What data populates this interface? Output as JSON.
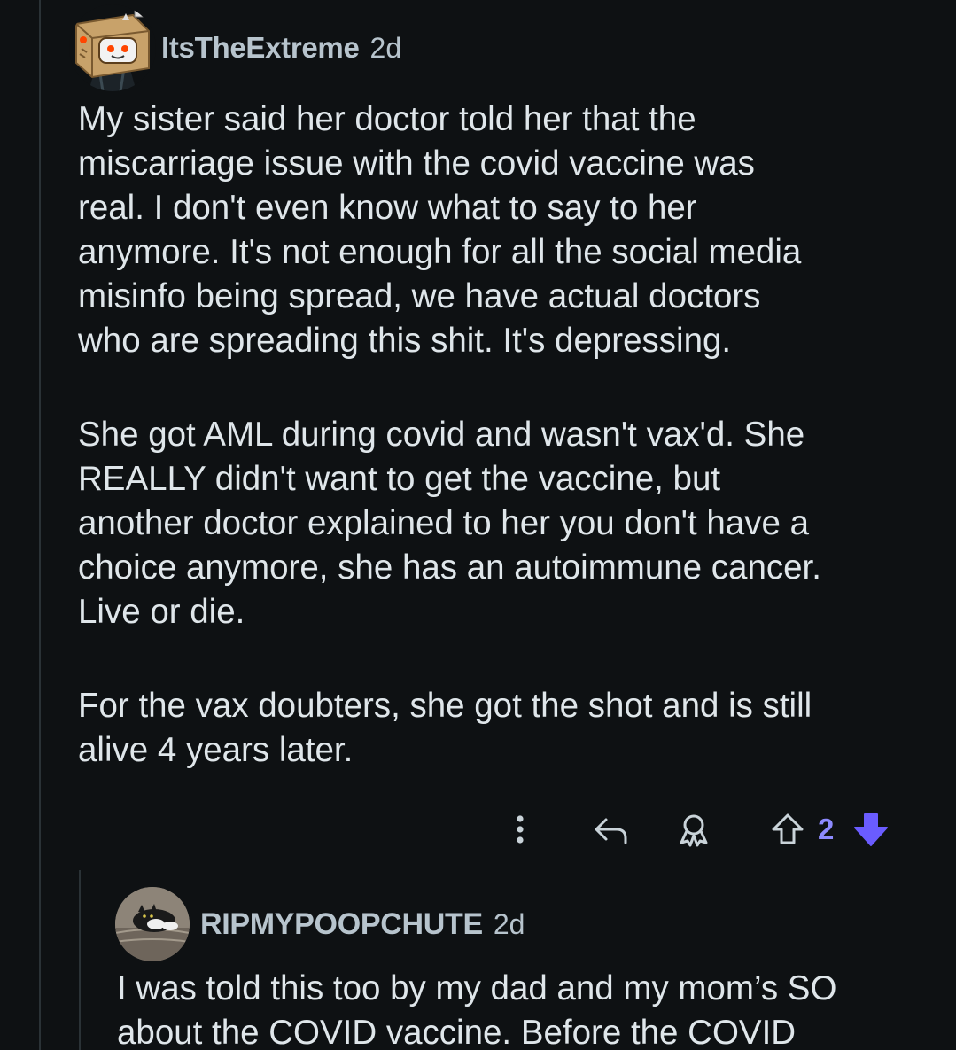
{
  "comments": [
    {
      "username": "ItsTheExtreme",
      "age": "2d",
      "avatar": "reddit-snoo-box-head-avatar",
      "paragraphs": [
        [
          "My sister said her doctor told her that the",
          "miscarriage issue with the covid vaccine was",
          "real. I don't even know what to say to her",
          "anymore. It's not enough for all the social media",
          "misinfo being spread, we have actual doctors",
          "who are spreading this shit. It's depressing."
        ],
        [
          "She got AML during covid and wasn't vax'd. She",
          "REALLY didn't want to get the vaccine, but",
          "another doctor explained to her you don't have a",
          "choice anymore, she has an autoimmune cancer.",
          "Live or die."
        ],
        [
          "For the vax doubters, she got the shot and is still",
          "alive 4 years later."
        ]
      ],
      "actions": {
        "more_icon": "more-vertical-icon",
        "reply_icon": "reply-icon",
        "award_icon": "award-icon",
        "upvote_icon": "upvote-icon",
        "score": "2",
        "downvote_icon": "downvote-filled-icon",
        "vote_state": "downvoted"
      }
    },
    {
      "username": "RIPMYPOOPCHUTE",
      "age": "2d",
      "avatar": "cat-photo-avatar",
      "paragraphs": [
        [
          "I was told this too by my dad and my mom’s SO",
          "about the COVID vaccine. Before the COVID"
        ]
      ]
    }
  ],
  "colors": {
    "background": "#0e1113",
    "text": "#dfe6ea",
    "meta": "#b7c4cd",
    "thread_line": "#2a3236",
    "vote_accent": "#6a5cff",
    "score": "#8d8aff"
  }
}
